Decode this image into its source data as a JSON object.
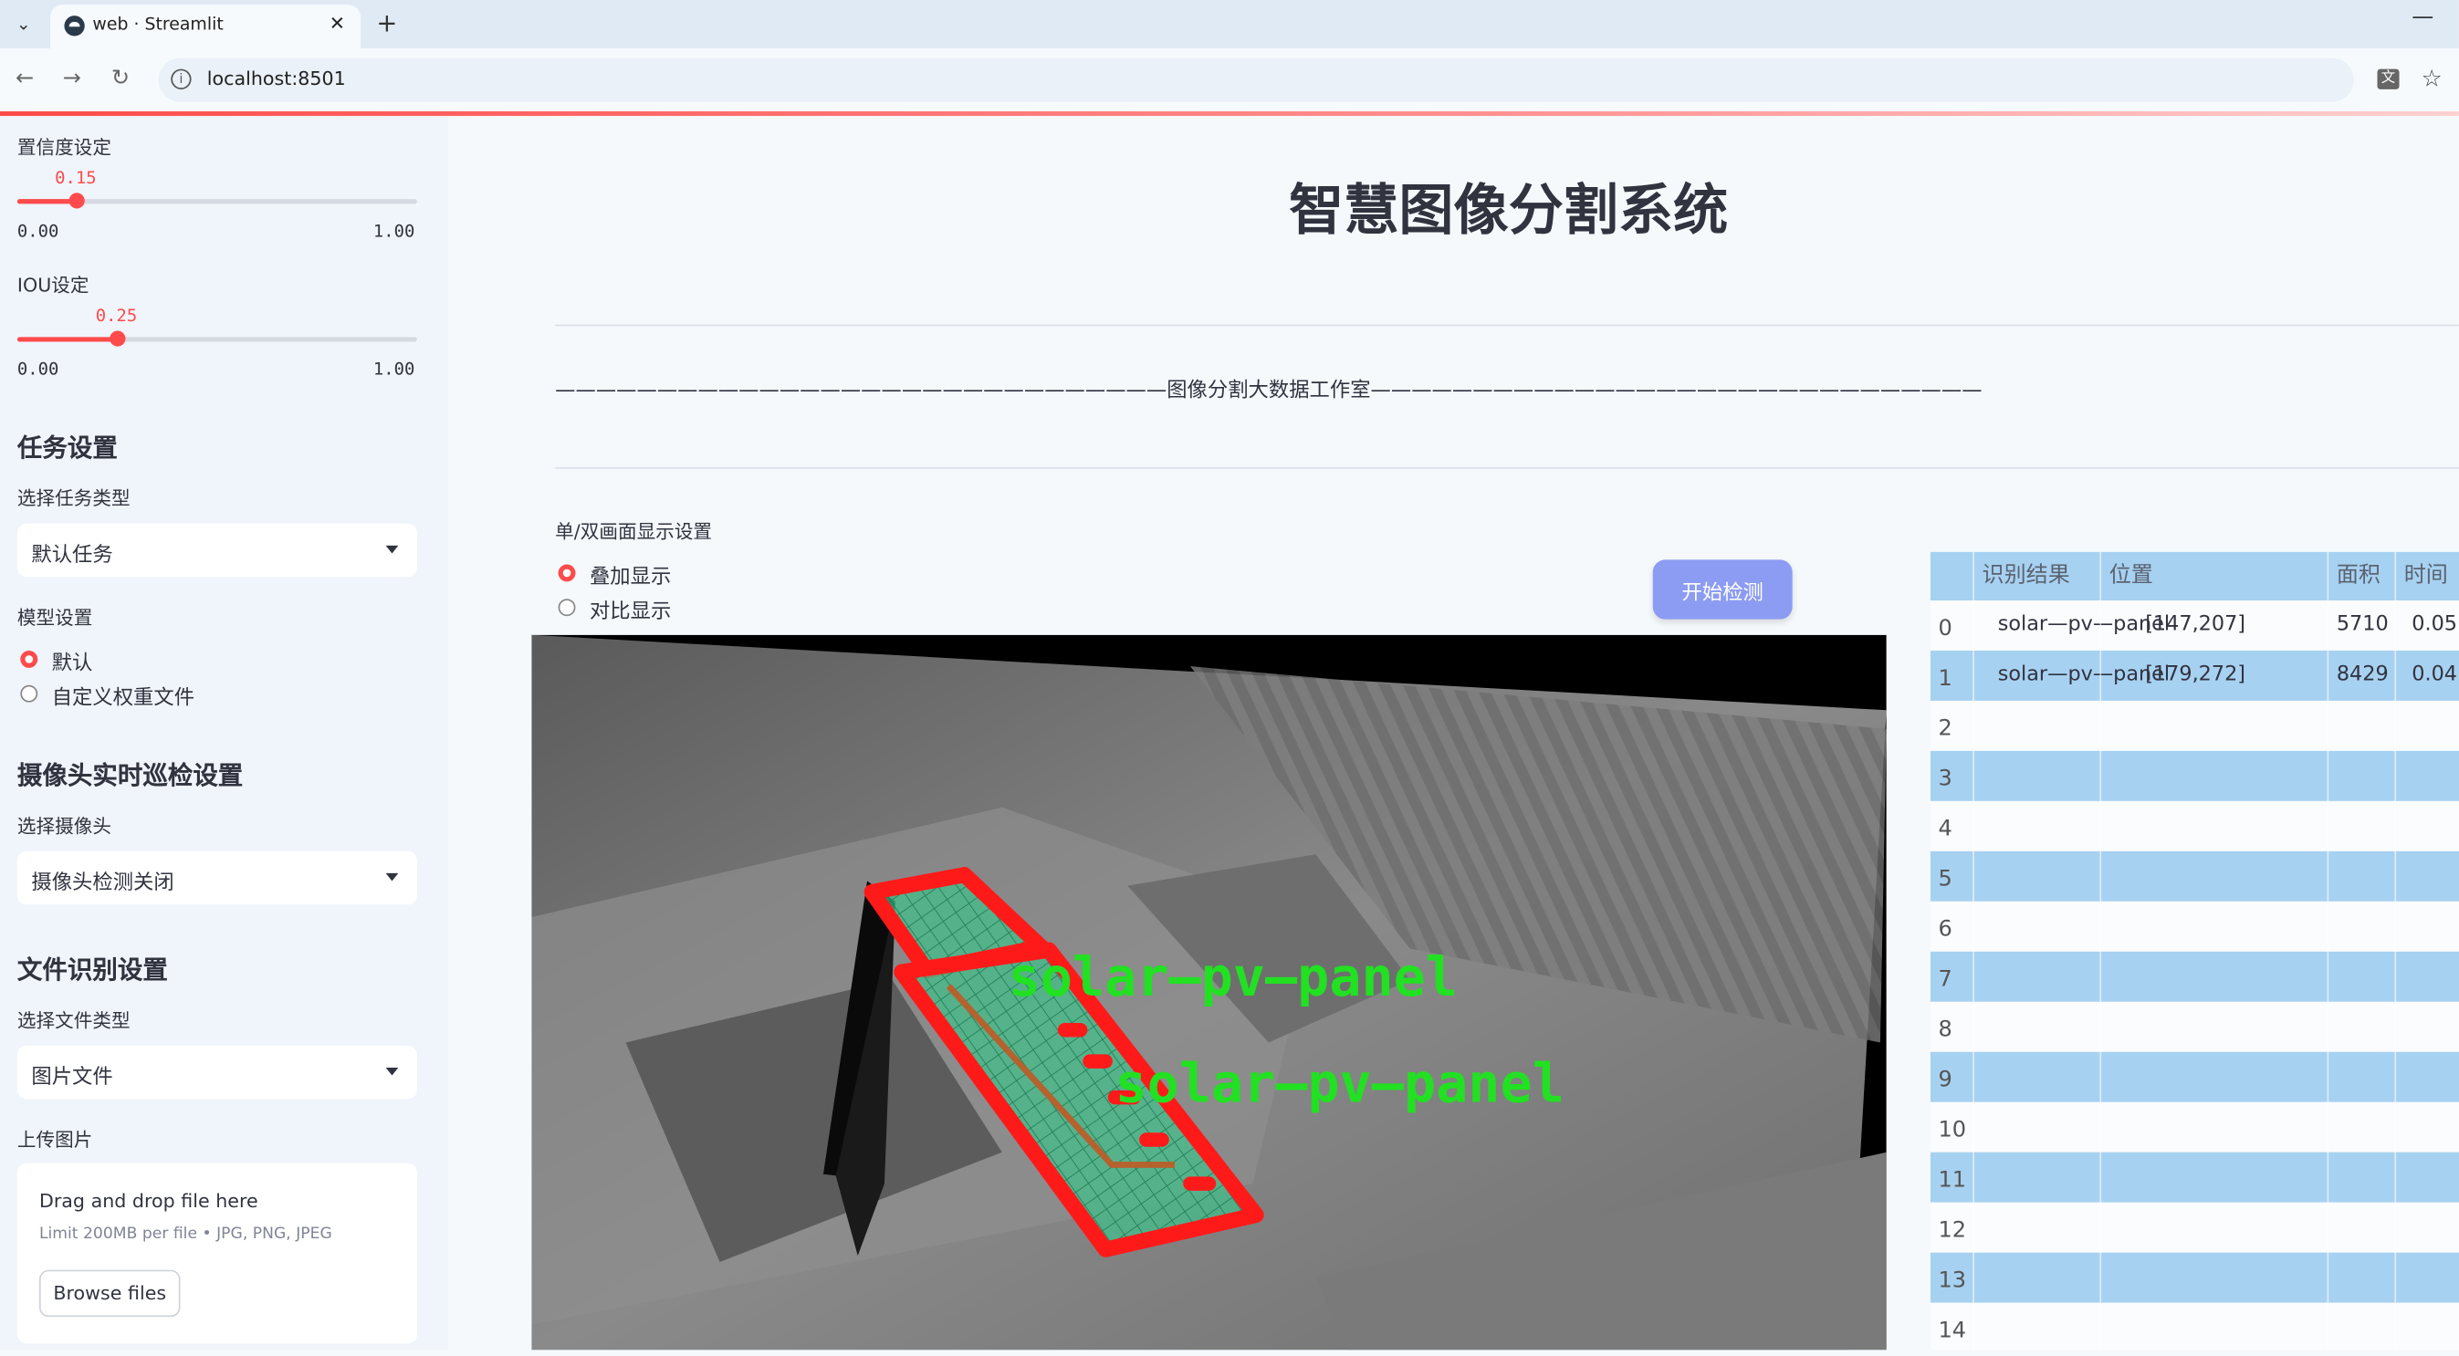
{
  "browser": {
    "tab_title": "web · Streamlit",
    "url": "localhost:8501"
  },
  "sidebar": {
    "confidence": {
      "label": "置信度设定",
      "value": 0.15,
      "value_text": "0.15",
      "min": "0.00",
      "max": "1.00"
    },
    "iou": {
      "label": "IOU设定",
      "value": 0.25,
      "value_text": "0.25",
      "min": "0.00",
      "max": "1.00"
    },
    "task_section": "任务设置",
    "task_type_label": "选择任务类型",
    "task_type_value": "默认任务",
    "model_label": "模型设置",
    "model_options": [
      "默认",
      "自定义权重文件"
    ],
    "model_selected": 0,
    "camera_section": "摄像头实时巡检设置",
    "camera_label": "选择摄像头",
    "camera_value": "摄像头检测关闭",
    "file_section": "文件识别设置",
    "file_type_label": "选择文件类型",
    "file_type_value": "图片文件",
    "upload_label": "上传图片",
    "upload_main": "Drag and drop file here",
    "upload_sub": "Limit 200MB per file • JPG, PNG, JPEG",
    "browse_label": "Browse files"
  },
  "main": {
    "title": "智慧图像分割系统",
    "banner": "——————————————————————————————图像分割大数据工作室——————————————————————————————",
    "display_label": "单/双画面显示设置",
    "display_options": [
      "叠加显示",
      "对比显示"
    ],
    "display_selected": 0,
    "detect_button": "开始检测",
    "overlay_labels": [
      "solar—pv—panel",
      "solar—pv—panel"
    ]
  },
  "table": {
    "headers": [
      "识别结果",
      "位置",
      "面积",
      "时间"
    ],
    "rows": [
      {
        "index": "0",
        "label": "solar—pv—panel",
        "position": "[147,207]",
        "area": "5710",
        "time": "0.05"
      },
      {
        "index": "1",
        "label": "solar—pv—panel",
        "position": "[179,272]",
        "area": "8429",
        "time": "0.04"
      },
      {
        "index": "2"
      },
      {
        "index": "3"
      },
      {
        "index": "4"
      },
      {
        "index": "5"
      },
      {
        "index": "6"
      },
      {
        "index": "7"
      },
      {
        "index": "8"
      },
      {
        "index": "9"
      },
      {
        "index": "10"
      },
      {
        "index": "11"
      },
      {
        "index": "12"
      },
      {
        "index": "13"
      },
      {
        "index": "14"
      }
    ]
  },
  "colors": {
    "accent": "#ff4b4b",
    "button": "#8c9cf2",
    "table_header": "#a7d1f1",
    "mask_outline": "#ff1a1a",
    "mask_fill": "#3fc28a",
    "label_green": "#22e022"
  }
}
